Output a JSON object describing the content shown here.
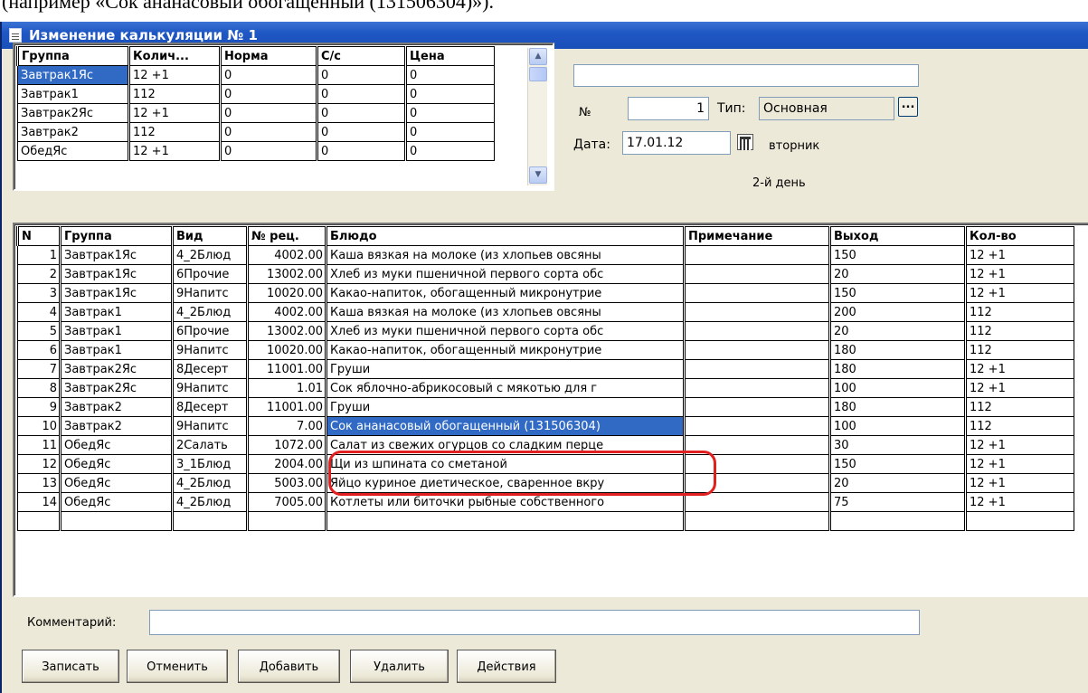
{
  "doc_fragment": "(например «Сок ананасовый обогащенный (131506304)»).",
  "window": {
    "title": "Изменение калькуляции № 1"
  },
  "groups_grid": {
    "columns": [
      "Группа",
      "Колич...",
      "Норма",
      "С/с",
      "Цена"
    ],
    "rows": [
      [
        "Завтрак1Яс",
        "12 +1",
        "0",
        "0",
        "0"
      ],
      [
        "Завтрак1",
        "112",
        "0",
        "0",
        "0"
      ],
      [
        "Завтрак2Яс",
        "12 +1",
        "0",
        "0",
        "0"
      ],
      [
        "Завтрак2",
        "112",
        "0",
        "0",
        "0"
      ],
      [
        "ОбедЯс",
        "12 +1",
        "0",
        "0",
        "0"
      ]
    ],
    "selected_row": 0
  },
  "header_form": {
    "name_value": "",
    "number_label": "№",
    "number_value": "1",
    "type_label": "Тип:",
    "type_value": "Основная",
    "dots_label": "...",
    "date_label": "Дата:",
    "date_value": "17.01.12",
    "weekday": "вторник",
    "day_label": "2-й день"
  },
  "dishes_grid": {
    "columns": [
      "N",
      "Группа",
      "Вид",
      "№ рец.",
      "Блюдо",
      "Примечание",
      "Выход",
      "Кол-во"
    ],
    "rows": [
      [
        "1",
        "Завтрак1Яс",
        "4_2Блюд",
        "4002.00",
        "Каша вязкая на молоке (из хлопьев овсяны",
        "",
        "150",
        "12 +1"
      ],
      [
        "2",
        "Завтрак1Яс",
        "6Прочие",
        "13002.00",
        "Хлеб из муки пшеничной первого сорта обс",
        "",
        "20",
        "12 +1"
      ],
      [
        "3",
        "Завтрак1Яс",
        "9Напитс",
        "10020.00",
        "Какао-напиток, обогащенный микронутрие",
        "",
        "150",
        "12 +1"
      ],
      [
        "4",
        "Завтрак1",
        "4_2Блюд",
        "4002.00",
        "Каша вязкая на молоке (из хлопьев овсяны",
        "",
        "200",
        "112"
      ],
      [
        "5",
        "Завтрак1",
        "6Прочие",
        "13002.00",
        "Хлеб из муки пшеничной первого сорта обс",
        "",
        "20",
        "112"
      ],
      [
        "6",
        "Завтрак1",
        "9Напитс",
        "10020.00",
        "Какао-напиток, обогащенный микронутрие",
        "",
        "180",
        "112"
      ],
      [
        "7",
        "Завтрак2Яс",
        "8Десерт",
        "11001.00",
        "Груши",
        "",
        "180",
        "12 +1"
      ],
      [
        "8",
        "Завтрак2Яс",
        "9Напитс",
        "1.01",
        "Сок яблочно-абрикосовый с мякотью  для г",
        "",
        "100",
        "12 +1"
      ],
      [
        "9",
        "Завтрак2",
        "8Десерт",
        "11001.00",
        "Груши",
        "",
        "180",
        "112"
      ],
      [
        "10",
        "Завтрак2",
        "9Напитс",
        "7.00",
        "Сок ананасовый обогащенный (131506304)",
        "",
        "100",
        "112"
      ],
      [
        "11",
        "ОбедЯс",
        "2Салать",
        "1072.00",
        "Салат из свежих огурцов со сладким перце",
        "",
        "30",
        "12 +1"
      ],
      [
        "12",
        "ОбедЯс",
        "3_1Блюд",
        "2004.00",
        "Щи из шпината со сметаной",
        "",
        "150",
        "12 +1"
      ],
      [
        "13",
        "ОбедЯс",
        "4_2Блюд",
        "5003.00",
        "Яйцо куриное диетическое, сваренное вкру",
        "",
        "20",
        "12 +1"
      ],
      [
        "14",
        "ОбедЯс",
        "4_2Блюд",
        "7005.00",
        "Котлеты или биточки рыбные собственного",
        "",
        "75",
        "12 +1"
      ],
      [
        "",
        "",
        "",
        "",
        "",
        "",
        "",
        ""
      ]
    ],
    "selected_row": 9,
    "selected_col": 4
  },
  "footer": {
    "comment_label": "Комментарий:",
    "comment_value": "",
    "buttons": [
      "Записать",
      "Отменить",
      "Добавить",
      "Удалить",
      "Действия"
    ]
  },
  "colors": {
    "title_bar": "#1f57c4",
    "selection": "#316ac5",
    "annotation_ring": "#e32020",
    "window_bg": "#ece9d8"
  }
}
